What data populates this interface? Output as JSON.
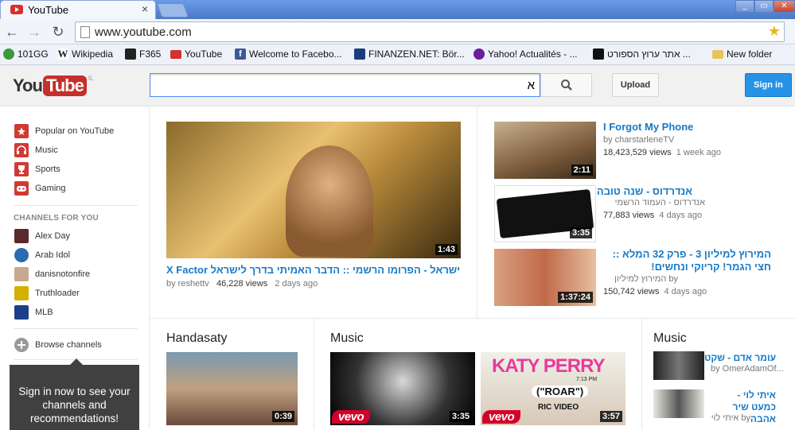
{
  "browser": {
    "tab_title": "YouTube",
    "tab_close": "×",
    "url": "www.youtube.com",
    "back": "←",
    "forward": "→",
    "reload": "↻",
    "star": "★",
    "win_min": "_",
    "win_max": "▭",
    "win_close": "✕",
    "bookmarks": [
      {
        "label": "101GG",
        "icon": "101gg-icon",
        "color": "#3a9a3a"
      },
      {
        "label": "Wikipedia",
        "icon": "wikipedia-icon",
        "color": "#444444"
      },
      {
        "label": "F365",
        "icon": "f365-icon",
        "color": "#222222"
      },
      {
        "label": "YouTube",
        "icon": "youtube-icon",
        "color": "#d6312d"
      },
      {
        "label": "Welcome to Facebo...",
        "icon": "facebook-icon",
        "color": "#3b5998"
      },
      {
        "label": "FINANZEN.NET: Bör...",
        "icon": "finanzen-icon",
        "color": "#1d3c7c"
      },
      {
        "label": "Yahoo! Actualités - ...",
        "icon": "yahoo-icon",
        "color": "#6b1f9c"
      },
      {
        "label": "אתר ערוץ הספורט ...",
        "icon": "sport5-icon",
        "color": "#111111"
      },
      {
        "label": "New folder",
        "icon": "folder-icon",
        "color": "#e9c35a"
      }
    ]
  },
  "header": {
    "logo_you": "You",
    "logo_tube": "Tube",
    "logo_region": "IL",
    "search_value": "א",
    "upload": "Upload",
    "signin": "Sign in"
  },
  "sidebar": {
    "items": [
      {
        "label": "Popular on YouTube",
        "icon": "popular-icon"
      },
      {
        "label": "Music",
        "icon": "music-headphones-icon"
      },
      {
        "label": "Sports",
        "icon": "sports-icon"
      },
      {
        "label": "Gaming",
        "icon": "gaming-icon"
      }
    ],
    "channels_heading": "CHANNELS FOR YOU",
    "channels": [
      {
        "label": "Alex Day",
        "color": "#5a2a2a"
      },
      {
        "label": "Arab Idol",
        "color": "#2a6bb0"
      },
      {
        "label": "danisnotonfire",
        "color": "#c8a890"
      },
      {
        "label": "Truthloader",
        "color": "#d4b000"
      },
      {
        "label": "MLB",
        "color": "#1b3f8a"
      }
    ],
    "browse": "Browse channels",
    "promo": "Sign in now to see your channels and recommendations!"
  },
  "featured": {
    "title": "X Factor ישראל - הפרומו הרשמי :: הדבר האמיתי בדרך לישראל",
    "title_ltr": "X Factor",
    "title_rtl": "ישראל - הפרומו הרשמי :: הדבר האמיתי בדרך לישראל",
    "by": "by reshettv",
    "views": "46,228 views",
    "age": "2 days ago",
    "duration": "1:43"
  },
  "side_videos": [
    {
      "title": "I Forgot My Phone",
      "by": "by charstarleneTV",
      "views": "18,423,529 views",
      "age": "1 week ago",
      "duration": "2:11",
      "rtl": false
    },
    {
      "title": "אנדרדוס - שנה טובה",
      "by": "אנדרדוס - העמוד הרשמי",
      "views": "77,883 views",
      "age": "4 days ago",
      "duration": "3:35",
      "rtl": true
    },
    {
      "title": "המירוץ למיליון 3 - פרק 32 המלא :: חצי הגמר! קריוקי ונחשים!",
      "by": "by המירוץ למיליון",
      "views": "150,742 views",
      "age": "4 days ago",
      "duration": "1:37:24",
      "rtl": true
    }
  ],
  "sections": {
    "handasaty": {
      "title": "Handasaty",
      "duration": "0:39"
    },
    "music": {
      "title": "Music",
      "videos": [
        {
          "duration": "3:35",
          "vevo": "vevo"
        },
        {
          "duration": "3:57",
          "vevo": "vevo",
          "katy": "KATY PERRY",
          "roar": "(\"ROAR\")",
          "ric": "RIC VIDEO",
          "time": "7:13 PM"
        }
      ]
    },
    "music2": {
      "title": "Music",
      "items": [
        {
          "title": "עומר אדם - שקט",
          "by": "by OmerAdamOf..."
        },
        {
          "title": "איתי לוי - כמעט שיר אהבה",
          "by": "by איתי לוי"
        }
      ]
    }
  }
}
